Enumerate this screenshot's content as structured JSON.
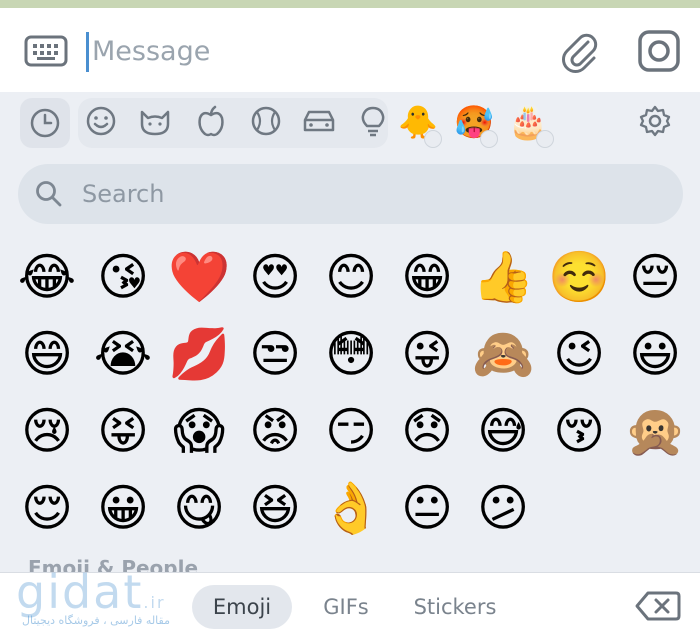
{
  "composer": {
    "placeholder": "Message",
    "keyboard_icon": "keyboard-icon",
    "attach_icon": "paperclip-icon",
    "camera_icon": "camera-icon"
  },
  "categories": [
    {
      "name": "recent",
      "icon": "clock-icon"
    },
    {
      "name": "smileys",
      "icon": "smiley-icon"
    },
    {
      "name": "animals",
      "icon": "cat-icon"
    },
    {
      "name": "food",
      "icon": "apple-icon"
    },
    {
      "name": "activity",
      "icon": "ball-icon"
    },
    {
      "name": "travel",
      "icon": "car-icon"
    },
    {
      "name": "objects",
      "icon": "lightbulb-icon"
    }
  ],
  "packs": [
    {
      "emoji": "🐥",
      "locked": true
    },
    {
      "emoji": "🥵",
      "locked": true
    },
    {
      "emoji": "🎂",
      "locked": true
    }
  ],
  "settings_icon": "gear-icon",
  "search": {
    "placeholder": "Search"
  },
  "emojis": [
    [
      "😂",
      "😘",
      "❤️",
      "😍",
      "😊",
      "😁",
      "👍",
      "☺️",
      "😔"
    ],
    [
      "😄",
      "😭",
      "💋",
      "😒",
      "😳",
      "😜",
      "🙈",
      "😉",
      "😃"
    ],
    [
      "😢",
      "😝",
      "😱",
      "😡",
      "😏",
      "😞",
      "😅",
      "😚",
      "🙊"
    ],
    [
      "😌",
      "😀",
      "😋",
      "😆",
      "👌",
      "😐",
      "😕"
    ]
  ],
  "section_title": "Emoji & People",
  "bottom_tabs": [
    {
      "label": "Emoji",
      "active": true
    },
    {
      "label": "GIFs",
      "active": false
    },
    {
      "label": "Stickers",
      "active": false
    }
  ],
  "backspace_icon": "backspace-icon",
  "watermark": {
    "brand": "gidat",
    "tld": ".ir",
    "tagline": "مقاله فارسی ، فروشگاه دیجیتال"
  }
}
